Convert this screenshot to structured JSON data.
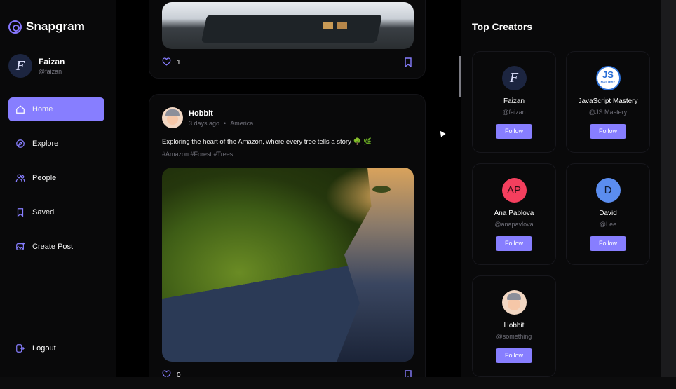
{
  "app": {
    "name": "Snapgram"
  },
  "user": {
    "name": "Faizan",
    "handle": "@faizan",
    "initial": "F"
  },
  "nav": [
    {
      "label": "Home",
      "icon": "home-icon",
      "active": true
    },
    {
      "label": "Explore",
      "icon": "explore-icon"
    },
    {
      "label": "People",
      "icon": "people-icon"
    },
    {
      "label": "Saved",
      "icon": "bookmark-icon"
    },
    {
      "label": "Create Post",
      "icon": "image-plus-icon"
    }
  ],
  "logout": {
    "label": "Logout"
  },
  "posts": [
    {
      "likes": "1"
    },
    {
      "author": "Hobbit",
      "time": "3 days ago",
      "location": "America",
      "caption": "Exploring the heart of the Amazon, where every tree tells a story 🌳 🌿",
      "tags": "#Amazon #Forest #Trees",
      "likes": "0"
    }
  ],
  "top_creators": {
    "title": "Top Creators",
    "follow_label": "Follow",
    "creators": [
      {
        "name": "Faizan",
        "handle": "@faizan",
        "avatar": "F",
        "color": "#1c2540"
      },
      {
        "name": "JavaScript Mastery",
        "handle": "@JS Mastery",
        "avatar": "JS",
        "avatar_sub": "MASTERY",
        "color": "#ffffff"
      },
      {
        "name": "Ana Pablova",
        "handle": "@anapavlova",
        "avatar": "AP",
        "color": "#f43f5e"
      },
      {
        "name": "David",
        "handle": "@Lee",
        "avatar": "D",
        "color": "#5b8def"
      },
      {
        "name": "Hobbit",
        "handle": "@something",
        "avatar": "hobbit-avatar",
        "color": "#f2d7c3"
      }
    ]
  },
  "colors": {
    "accent": "#877eff",
    "background": "#000000",
    "panel": "#09090a"
  }
}
